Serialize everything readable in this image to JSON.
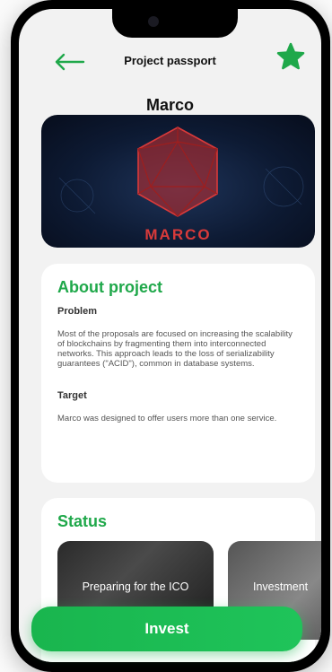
{
  "header": {
    "title": "Project passport",
    "back_icon": "arrow-left-icon",
    "favorite_icon": "star-icon",
    "accent_color": "#1fa84a"
  },
  "project": {
    "name": "Marco",
    "banner_logo_text": "MARCO"
  },
  "about": {
    "title": "About project",
    "problem_label": "Problem",
    "problem_text": "Most of the proposals are focused on increasing the scalability of blockchains by fragmenting them into interconnected networks. This approach leads to the loss of serializability guarantees (\"ACID\"), common in database systems.",
    "target_label": "Target",
    "target_text": "Marco was designed to offer users more than one service."
  },
  "status": {
    "title": "Status",
    "tiles": [
      {
        "label": "Preparing for the ICO"
      },
      {
        "label": "Investment"
      }
    ]
  },
  "actions": {
    "invest_label": "Invest"
  }
}
